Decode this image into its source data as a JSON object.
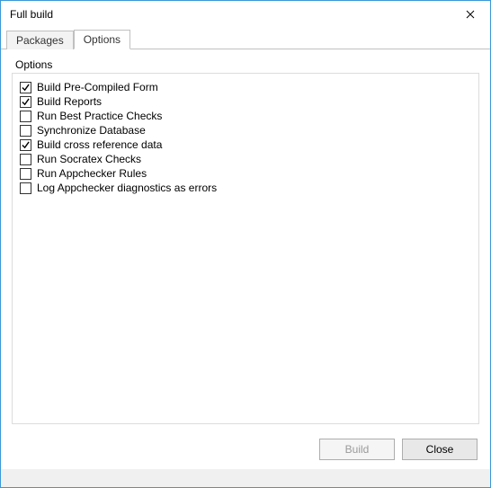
{
  "window": {
    "title": "Full build"
  },
  "tabs": [
    {
      "label": "Packages",
      "active": false
    },
    {
      "label": "Options",
      "active": true
    }
  ],
  "group": {
    "label": "Options"
  },
  "options": [
    {
      "label": "Build Pre-Compiled Form",
      "checked": true
    },
    {
      "label": "Build Reports",
      "checked": true
    },
    {
      "label": "Run Best Practice Checks",
      "checked": false
    },
    {
      "label": "Synchronize Database",
      "checked": false
    },
    {
      "label": "Build cross reference data",
      "checked": true
    },
    {
      "label": "Run Socratex Checks",
      "checked": false
    },
    {
      "label": "Run Appchecker Rules",
      "checked": false
    },
    {
      "label": "Log Appchecker diagnostics as errors",
      "checked": false
    }
  ],
  "buttons": {
    "build": "Build",
    "close": "Close"
  }
}
